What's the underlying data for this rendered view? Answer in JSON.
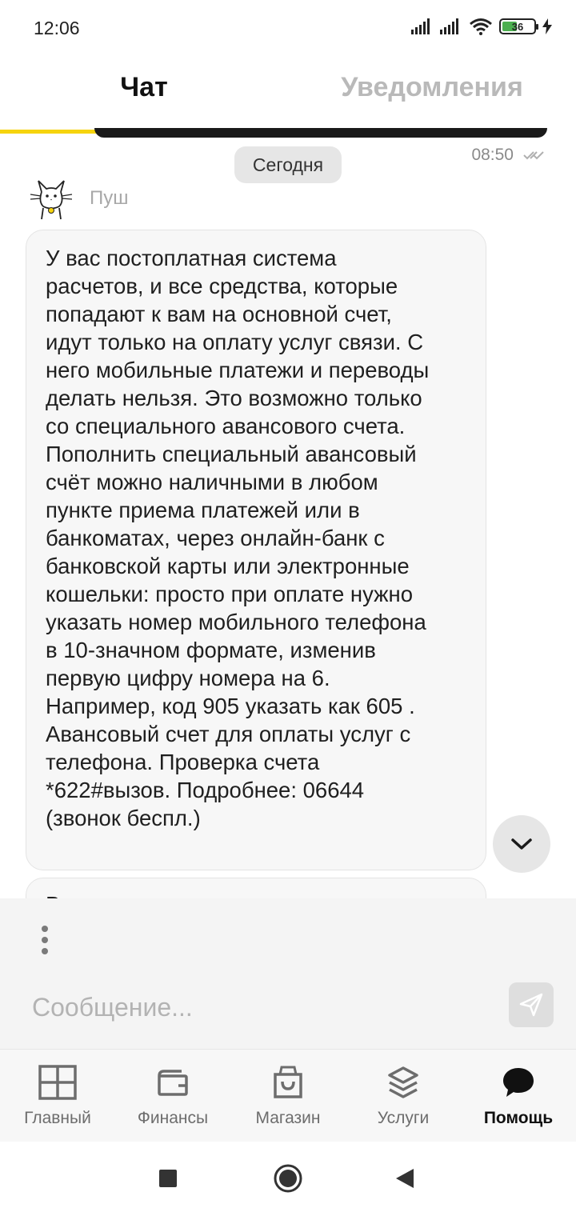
{
  "status_bar": {
    "time": "12:06",
    "battery": "36"
  },
  "tabs": {
    "chat": "Чат",
    "notifications": "Уведомления"
  },
  "chat": {
    "date_label": "Сегодня",
    "time": "08:50",
    "sender": "Пуш",
    "messages": [
      {
        "text": "У вас постоплатная система\nрасчетов, и все средства, которые\nпопадают к вам на основной счет,\nидут только на оплату услуг связи. С\nнего мобильные платежи и переводы\nделать нельзя. Это возможно только\nсо специального авансового счета.\nПополнить специальный авансовый\nсчёт можно наличными в любом\nпункте приема платежей или в\nбанкоматах, через онлайн-банк с\nбанковской карты или электронные\nкошельки: просто при оплате нужно\nуказать номер мобильного телефона\nв 10-значном формате, изменив\nпервую цифру номера на 6.\nНапример, код 905 указать как 605 .\nАвансовый счет для оплаты услуг с\nтелефона. Проверка счета\n*622#вызов. Подробнее: 06644\n(звонок беспл.)"
      },
      {
        "text": "В"
      }
    ]
  },
  "composer": {
    "placeholder": "Сообщение..."
  },
  "bottom_nav": {
    "items": [
      {
        "label": "Главный",
        "icon": "dashboard-icon"
      },
      {
        "label": "Финансы",
        "icon": "wallet-icon"
      },
      {
        "label": "Магазин",
        "icon": "shopping-bag-icon"
      },
      {
        "label": "Услуги",
        "icon": "layers-icon"
      },
      {
        "label": "Помощь",
        "icon": "chat-bubble-icon"
      }
    ],
    "active": "Помощь"
  },
  "colors": {
    "accent": "#f6d40e",
    "bubble_bg": "#f7f7f7",
    "nav_bg": "#f7f7f7"
  }
}
